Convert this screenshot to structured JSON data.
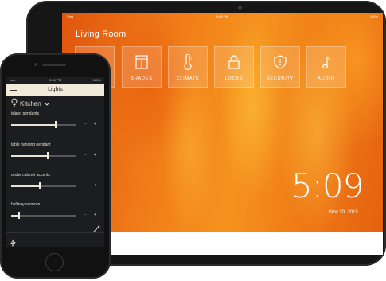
{
  "tablet": {
    "status": {
      "carrier": "iPad",
      "time": "9:09 PM",
      "battery": "100%"
    },
    "room_title": "Living Room",
    "tiles": [
      {
        "label": "",
        "icon": "lightbulb-icon"
      },
      {
        "label": "SHADES",
        "icon": "shades-icon"
      },
      {
        "label": "CLIMATE",
        "icon": "thermometer-icon"
      },
      {
        "label": "LOCKS",
        "icon": "lock-icon"
      },
      {
        "label": "SECURITY",
        "icon": "shield-icon"
      },
      {
        "label": "AUDIO",
        "icon": "music-note-icon"
      }
    ],
    "clock": {
      "time": "5:09",
      "date": "Nov 20, 2015"
    }
  },
  "phone": {
    "status": {
      "carrier": "•••••",
      "time": "9:09 PM",
      "battery": "100%"
    },
    "title": "Lights",
    "room": "Kitchen",
    "lights": [
      {
        "name": "island pendants",
        "level": 0.68,
        "off_label": "",
        "dash_label": "–",
        "on_label": "+"
      },
      {
        "name": "table hanging pendant",
        "level": 0.56,
        "off_label": "",
        "dash_label": "–",
        "on_label": "+"
      },
      {
        "name": "under cabinet accents",
        "level": 0.44,
        "off_label": "",
        "dash_label": "–",
        "on_label": "+"
      },
      {
        "name": "hallway sconces",
        "level": 0.12,
        "off_label": "",
        "dash_label": "–",
        "on_label": "+"
      }
    ]
  },
  "colors": {
    "tablet_bg": "#e46010",
    "phone_header": "#f1ead9",
    "phone_bg": "#1c1d20",
    "accent_text": "#ffffff"
  }
}
